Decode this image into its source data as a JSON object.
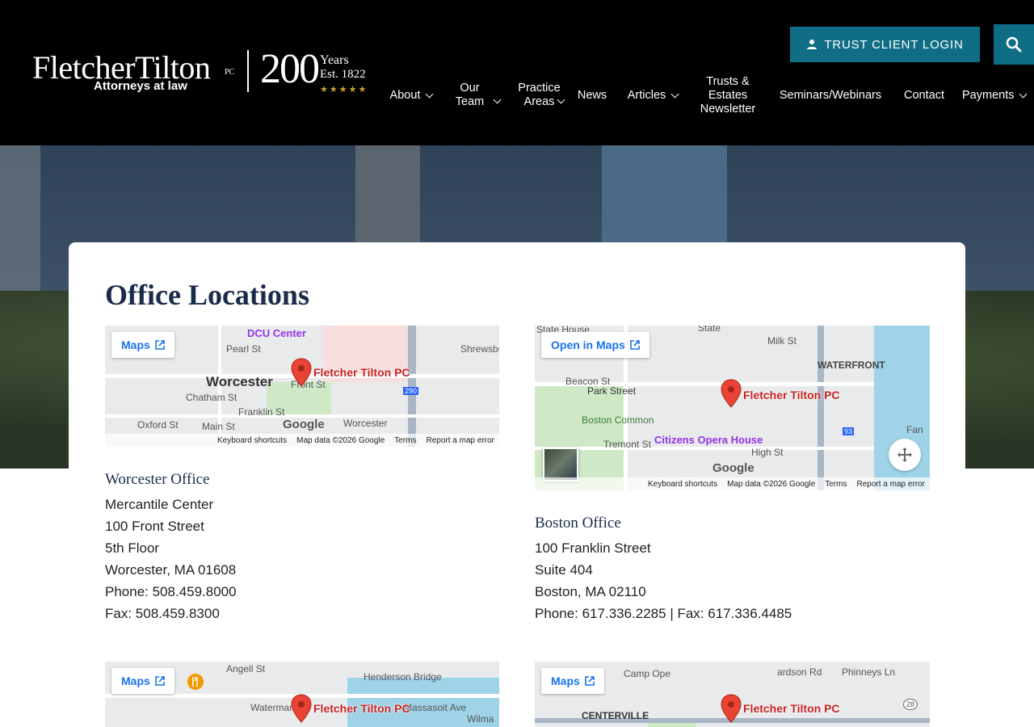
{
  "header": {
    "logo": {
      "name": "FletcherTilton",
      "pc": "PC",
      "tagline": "Attorneys at law",
      "anniversary": "200",
      "years": "Years",
      "established": "Est. 1822",
      "stars": "★★★★★"
    },
    "login_label": "TRUST CLIENT LOGIN",
    "nav": [
      {
        "label": "About",
        "dropdown": true
      },
      {
        "label": "Our Team",
        "dropdown": true
      },
      {
        "label": "Practice Areas",
        "dropdown": true
      },
      {
        "label": "News",
        "dropdown": false
      },
      {
        "label": "Articles",
        "dropdown": true
      },
      {
        "label": "Trusts & Estates Newsletter",
        "dropdown": false
      },
      {
        "label": "Seminars/Webinars",
        "dropdown": false
      },
      {
        "label": "Contact",
        "dropdown": false
      },
      {
        "label": "Payments",
        "dropdown": true
      }
    ]
  },
  "page": {
    "title": "Office Locations"
  },
  "map_common": {
    "pin_label": "Fletcher Tilton PC",
    "keyboard_shortcuts": "Keyboard shortcuts",
    "map_data": "Map data ©2026 Google",
    "terms": "Terms",
    "report": "Report a map error",
    "google": "Google"
  },
  "maps": {
    "worcester": {
      "button": "Maps",
      "streets": [
        "Pearl St",
        "Worcester",
        "Chatham St",
        "Franklin St",
        "Front St",
        "Main St",
        "Oxford St",
        "Shrewsbury",
        "Worcester"
      ],
      "places": [
        "DCU Center"
      ],
      "highway": "290"
    },
    "boston": {
      "button": "Open in Maps",
      "streets": [
        "State House",
        "State",
        "Milk St",
        "WATERFRONT",
        "Beacon St",
        "Park Street",
        "Boston Common",
        "Tremont St",
        "High St",
        "Fan"
      ],
      "places": [
        "Citizens Opera House"
      ],
      "highway": "93"
    },
    "bottom_left": {
      "button": "Maps",
      "streets": [
        "Henderson Bridge",
        "Waterman St",
        "Massasoit Ave",
        "Angell St",
        "Wilma"
      ]
    },
    "bottom_right": {
      "button": "Maps",
      "streets": [
        "CENTERVILLE",
        "Camp Ope",
        "Phinneys Ln",
        "ardson Rd"
      ],
      "highway": "28"
    }
  },
  "offices": {
    "worcester": {
      "title": "Worcester Office",
      "lines": [
        "Mercantile Center",
        "100 Front Street",
        "5th Floor",
        "Worcester, MA 01608",
        "Phone: 508.459.8000",
        "Fax: 508.459.8300"
      ]
    },
    "boston": {
      "title": "Boston Office",
      "lines": [
        "100 Franklin Street",
        "Suite 404",
        "Boston, MA 02110",
        "Phone: 617.336.2285 | Fax: 617.336.4485"
      ]
    }
  },
  "colors": {
    "accent": "#0f6e86",
    "heading": "#1a2b4a",
    "pin": "#ea4335",
    "map_link": "#1a73e8"
  }
}
